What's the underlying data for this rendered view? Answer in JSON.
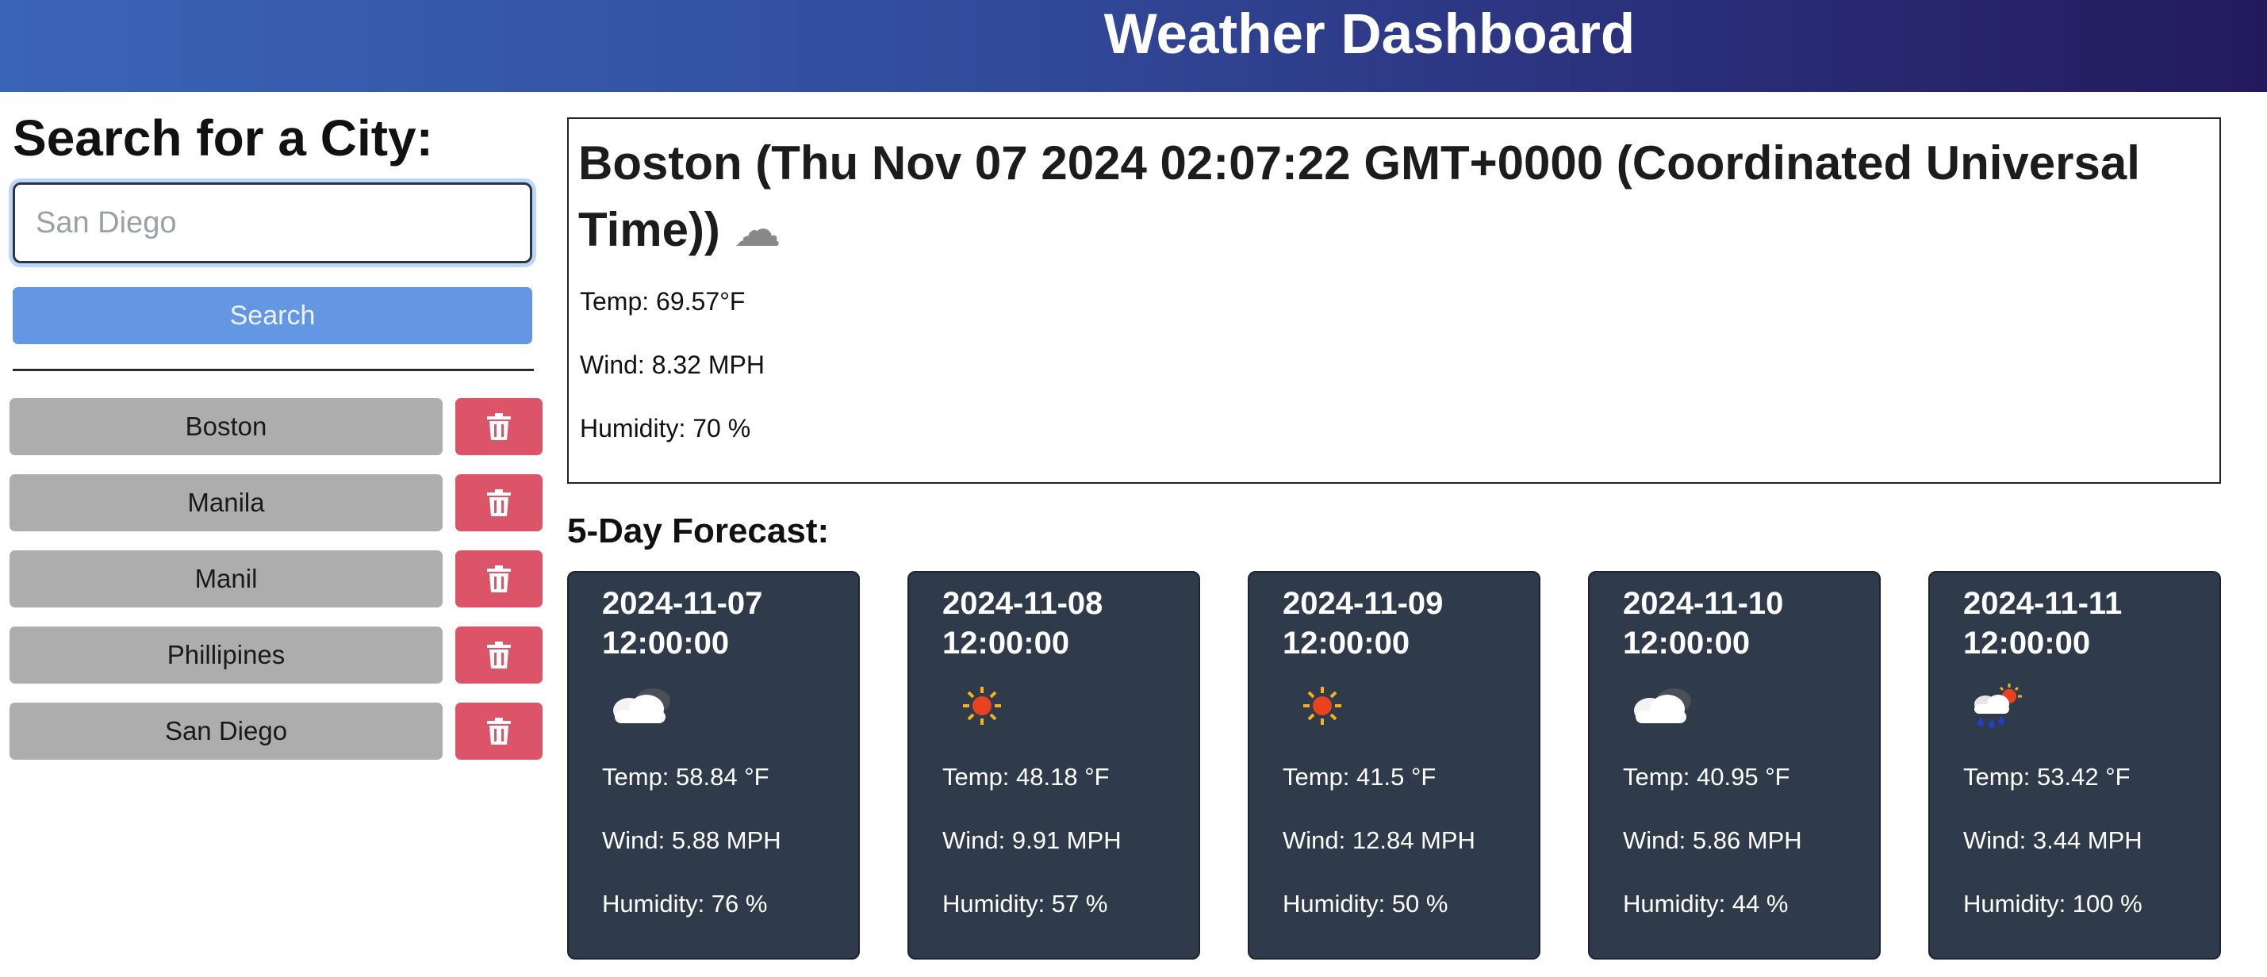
{
  "header": {
    "title": "Weather Dashboard"
  },
  "sidebar": {
    "heading": "Search for a City:",
    "search_placeholder": "San Diego",
    "search_button": "Search",
    "history": [
      "Boston",
      "Manila",
      "Manil",
      "Phillipines",
      "San Diego"
    ],
    "delete_icon": "trash-icon"
  },
  "current": {
    "title": "Boston (Thu Nov 07 2024 02:07:22 GMT+0000 (Coordinated Universal Time))",
    "icon": "cloud-icon",
    "temp": "Temp: 69.57°F",
    "wind": "Wind: 8.32 MPH",
    "humidity": "Humidity: 70 %"
  },
  "forecast": {
    "heading": "5-Day Forecast:",
    "days": [
      {
        "date": "2024-11-07 12:00:00",
        "icon": "cloud-icon",
        "temp": "Temp: 58.84 °F",
        "wind": "Wind: 5.88 MPH",
        "humidity": "Humidity: 76 %"
      },
      {
        "date": "2024-11-08 12:00:00",
        "icon": "sun-icon",
        "temp": "Temp: 48.18 °F",
        "wind": "Wind: 9.91 MPH",
        "humidity": "Humidity: 57 %"
      },
      {
        "date": "2024-11-09 12:00:00",
        "icon": "sun-icon",
        "temp": "Temp: 41.5 °F",
        "wind": "Wind: 12.84 MPH",
        "humidity": "Humidity: 50 %"
      },
      {
        "date": "2024-11-10 12:00:00",
        "icon": "cloud-icon",
        "temp": "Temp: 40.95 °F",
        "wind": "Wind: 5.86 MPH",
        "humidity": "Humidity: 44 %"
      },
      {
        "date": "2024-11-11 12:00:00",
        "icon": "rain-sun-icon",
        "temp": "Temp: 53.42 °F",
        "wind": "Wind: 3.44 MPH",
        "humidity": "Humidity: 100 %"
      }
    ]
  },
  "colors": {
    "header_start": "#3a64b8",
    "header_end": "#231a5e",
    "search_button": "#6497e3",
    "history_button": "#adadad",
    "delete_button": "#dc5467",
    "card_background": "#2f3b4b"
  }
}
